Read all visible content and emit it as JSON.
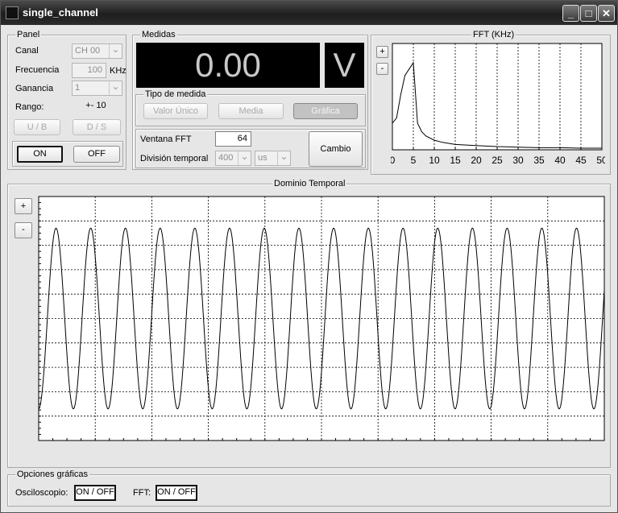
{
  "window": {
    "title": "single_channel",
    "controls": {
      "minimize": "_",
      "maximize": "□",
      "close": "✕"
    }
  },
  "panel": {
    "title": "Panel",
    "canal_label": "Canal",
    "canal_value": "CH 00",
    "frecuencia_label": "Frecuencia",
    "frecuencia_value": "100",
    "frecuencia_unit": "KHz",
    "ganancia_label": "Ganancia",
    "ganancia_value": "1",
    "rango_label": "Rango:",
    "rango_value": "+- 10",
    "ub_label": "U / B",
    "ds_label": "D / S",
    "on_label": "ON",
    "off_label": "OFF"
  },
  "medidas": {
    "title": "Medidas",
    "value": "0.00",
    "unit": "V",
    "tipo_title": "Tipo de medida",
    "valor_unico": "Valor Único",
    "media": "Media",
    "grafica": "Gráfica",
    "ventana_label": "Ventana FFT",
    "ventana_value": "64",
    "division_label": "División temporal",
    "division_value": "400",
    "division_unit": "us",
    "cambio": "Cambio"
  },
  "fft": {
    "title": "FFT (KHz)",
    "zoom_in": "+",
    "zoom_out": "-",
    "chart_data": {
      "type": "line",
      "title": "FFT (KHz)",
      "x_ticks": [
        "0",
        "5",
        "10",
        "15",
        "20",
        "25",
        "30",
        "35",
        "40",
        "45",
        "50"
      ],
      "xlim": [
        0,
        50
      ],
      "ylim": [
        0,
        1
      ],
      "grid": "vertical dashed",
      "series": [
        {
          "x": [
            0,
            1,
            2,
            3,
            4,
            5,
            6,
            7,
            8,
            10,
            12,
            15,
            20,
            25,
            30,
            35,
            40,
            45,
            50
          ],
          "y": [
            0.25,
            0.3,
            0.52,
            0.7,
            0.76,
            0.82,
            0.25,
            0.17,
            0.13,
            0.09,
            0.07,
            0.05,
            0.04,
            0.03,
            0.025,
            0.02,
            0.02,
            0.015,
            0.015
          ]
        }
      ]
    }
  },
  "temporal": {
    "title": "Dominio Temporal",
    "zoom_in": "+",
    "zoom_out": "-",
    "chart_data": {
      "type": "line",
      "title": "Dominio Temporal",
      "xlim": [
        0,
        16.3
      ],
      "ylim": [
        -1.35,
        1.35
      ],
      "grid": "dashed, 10 vertical x 10 horizontal divisions",
      "series": [
        {
          "waveform": "sine",
          "amplitude": 1,
          "cycles": 16.3,
          "phase_deg": -90
        }
      ]
    }
  },
  "opciones": {
    "title": "Opciones gráficas",
    "osc_label": "Osciloscopio:",
    "osc_btn": "ON / OFF",
    "fft_label": "FFT:",
    "fft_btn": "ON / OFF"
  }
}
